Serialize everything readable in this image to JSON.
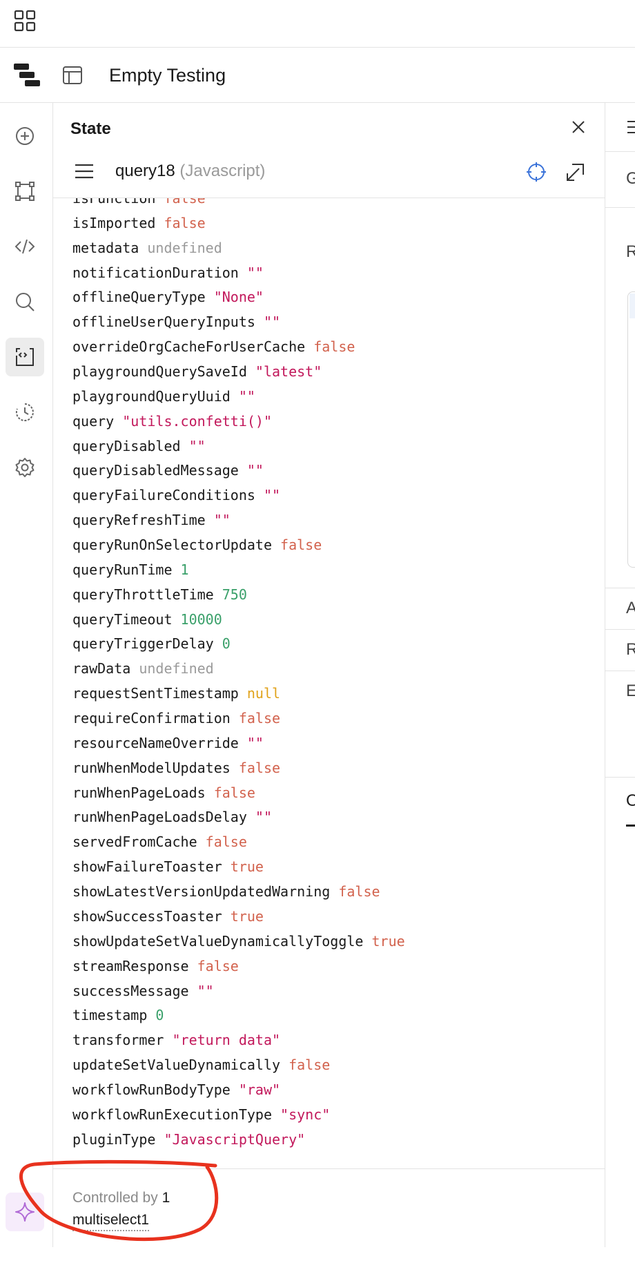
{
  "app": {
    "title": "Empty Testing"
  },
  "panel": {
    "title": "State",
    "query": {
      "name": "query18",
      "type": "(Javascript)"
    }
  },
  "state_rows": [
    {
      "key": "isFunction",
      "value": "false",
      "kind": "bool"
    },
    {
      "key": "isImported",
      "value": "false",
      "kind": "bool"
    },
    {
      "key": "metadata",
      "value": "undefined",
      "kind": "undef"
    },
    {
      "key": "notificationDuration",
      "value": "\"\"",
      "kind": "str"
    },
    {
      "key": "offlineQueryType",
      "value": "\"None\"",
      "kind": "str"
    },
    {
      "key": "offlineUserQueryInputs",
      "value": "\"\"",
      "kind": "str"
    },
    {
      "key": "overrideOrgCacheForUserCache",
      "value": "false",
      "kind": "bool"
    },
    {
      "key": "playgroundQuerySaveId",
      "value": "\"latest\"",
      "kind": "str"
    },
    {
      "key": "playgroundQueryUuid",
      "value": "\"\"",
      "kind": "str"
    },
    {
      "key": "query",
      "value": "\"utils.confetti()\"",
      "kind": "str"
    },
    {
      "key": "queryDisabled",
      "value": "\"\"",
      "kind": "str"
    },
    {
      "key": "queryDisabledMessage",
      "value": "\"\"",
      "kind": "str"
    },
    {
      "key": "queryFailureConditions",
      "value": "\"\"",
      "kind": "str"
    },
    {
      "key": "queryRefreshTime",
      "value": "\"\"",
      "kind": "str"
    },
    {
      "key": "queryRunOnSelectorUpdate",
      "value": "false",
      "kind": "bool"
    },
    {
      "key": "queryRunTime",
      "value": "1",
      "kind": "num"
    },
    {
      "key": "queryThrottleTime",
      "value": "750",
      "kind": "num"
    },
    {
      "key": "queryTimeout",
      "value": "10000",
      "kind": "num"
    },
    {
      "key": "queryTriggerDelay",
      "value": "0",
      "kind": "num"
    },
    {
      "key": "rawData",
      "value": "undefined",
      "kind": "undef"
    },
    {
      "key": "requestSentTimestamp",
      "value": "null",
      "kind": "null"
    },
    {
      "key": "requireConfirmation",
      "value": "false",
      "kind": "bool"
    },
    {
      "key": "resourceNameOverride",
      "value": "\"\"",
      "kind": "str"
    },
    {
      "key": "runWhenModelUpdates",
      "value": "false",
      "kind": "bool"
    },
    {
      "key": "runWhenPageLoads",
      "value": "false",
      "kind": "bool"
    },
    {
      "key": "runWhenPageLoadsDelay",
      "value": "\"\"",
      "kind": "str"
    },
    {
      "key": "servedFromCache",
      "value": "false",
      "kind": "bool"
    },
    {
      "key": "showFailureToaster",
      "value": "true",
      "kind": "bool"
    },
    {
      "key": "showLatestVersionUpdatedWarning",
      "value": "false",
      "kind": "bool"
    },
    {
      "key": "showSuccessToaster",
      "value": "true",
      "kind": "bool"
    },
    {
      "key": "showUpdateSetValueDynamicallyToggle",
      "value": "true",
      "kind": "bool"
    },
    {
      "key": "streamResponse",
      "value": "false",
      "kind": "bool"
    },
    {
      "key": "successMessage",
      "value": "\"\"",
      "kind": "str"
    },
    {
      "key": "timestamp",
      "value": "0",
      "kind": "num"
    },
    {
      "key": "transformer",
      "value": "\"return data\"",
      "kind": "str"
    },
    {
      "key": "updateSetValueDynamically",
      "value": "false",
      "kind": "bool"
    },
    {
      "key": "workflowRunBodyType",
      "value": "\"raw\"",
      "kind": "str"
    },
    {
      "key": "workflowRunExecutionType",
      "value": "\"sync\"",
      "kind": "str"
    },
    {
      "key": "pluginType",
      "value": "\"JavascriptQuery\"",
      "kind": "str"
    }
  ],
  "footer": {
    "controlled_by_label": "Controlled by",
    "controlled_by_count": "1",
    "controller_name": "multiselect1"
  },
  "right_panel": {
    "letters": [
      "G",
      "R",
      "A",
      "R",
      "E",
      "O"
    ]
  },
  "icons": {
    "top": "apps-grid-icon",
    "app_logo": "retool-logo-icon",
    "layout": "layout-icon",
    "sidebar": [
      "add-circle-icon",
      "component-tree-icon",
      "code-icon",
      "search-icon",
      "state-icon",
      "history-icon",
      "settings-icon",
      "sparkle-ai-icon"
    ]
  },
  "colors": {
    "bool": "#d2624d",
    "string": "#c2185b",
    "number": "#3aa06a",
    "undefined": "#9a9a9a",
    "null": "#e0a21a",
    "accent": "#3b73d9",
    "annotation": "#e8321e"
  }
}
